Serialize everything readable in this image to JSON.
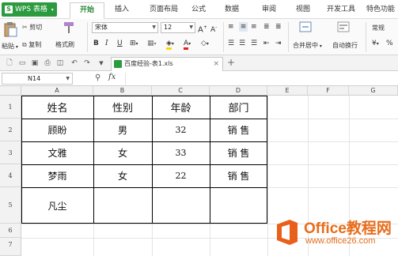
{
  "app": {
    "name": "WPS 表格",
    "logo_letter": "S"
  },
  "menu": {
    "tabs": [
      "开始",
      "插入",
      "页面布局",
      "公式",
      "数据",
      "审阅",
      "视图",
      "开发工具",
      "特色功能"
    ],
    "active": "开始"
  },
  "ribbon": {
    "cut": "剪切",
    "paste": "粘贴",
    "copy": "复制",
    "format_painter": "格式刷",
    "font_name": "宋体",
    "font_size": "12",
    "merge_center": "合并居中",
    "wrap_text": "自动换行",
    "number_format": "常规",
    "percent": "%"
  },
  "document": {
    "tab_title": "百度经验-表1.xls"
  },
  "formula_bar": {
    "name_box": "N14",
    "fx": "fx"
  },
  "columns": [
    "A",
    "B",
    "C",
    "D",
    "E",
    "F",
    "G"
  ],
  "rows": [
    "1",
    "2",
    "3",
    "4",
    "5",
    "6",
    "7"
  ],
  "table": {
    "headers": [
      "姓名",
      "性别",
      "年龄",
      "部门"
    ],
    "rows": [
      [
        "顾盼",
        "男",
        "32",
        "销 售"
      ],
      [
        "文雅",
        "女",
        "33",
        "销 售"
      ],
      [
        "梦雨",
        "女",
        "22",
        "销 售"
      ],
      [
        "凡尘",
        "",
        "",
        ""
      ]
    ]
  },
  "watermark": {
    "brand": "Office教程网",
    "url": "www.office26.com"
  }
}
